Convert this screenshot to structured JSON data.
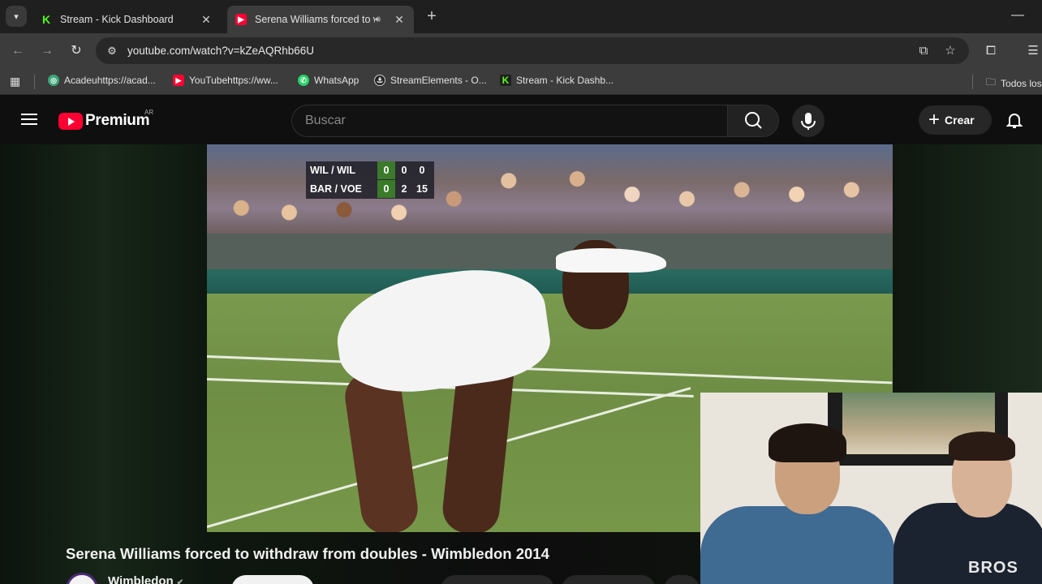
{
  "browser": {
    "tabs": [
      {
        "title": "Stream - Kick Dashboard",
        "active": false
      },
      {
        "title": "Serena Williams forced to wi",
        "active": true
      }
    ],
    "url": "youtube.com/watch?v=kZeAQRhb66U",
    "bookmarks": [
      {
        "label": "Acadeuhttps://acad..."
      },
      {
        "label": "YouTubehttps://ww..."
      },
      {
        "label": "WhatsApp"
      },
      {
        "label": "StreamElements - O..."
      },
      {
        "label": "Stream - Kick Dashb..."
      }
    ],
    "bookmarks_folder": "Todos los"
  },
  "youtube": {
    "logo_text": "Premium",
    "country_code": "AR",
    "search_placeholder": "Buscar",
    "create_label": "Crear"
  },
  "video": {
    "title": "Serena Williams forced to withdraw from doubles - Wimbledon 2014",
    "channel": "Wimbledon",
    "scoreboard": [
      {
        "team": "WIL / WIL",
        "sets": "0",
        "games": "0",
        "points": "0"
      },
      {
        "team": "BAR / VOE",
        "sets": "0",
        "games": "2",
        "points": "15"
      }
    ]
  },
  "webcam": {
    "shirt_text": "BROS"
  },
  "colors": {
    "youtube_red": "#ff0033",
    "kick_green": "#53fc18",
    "whatsapp_green": "#25d366"
  }
}
